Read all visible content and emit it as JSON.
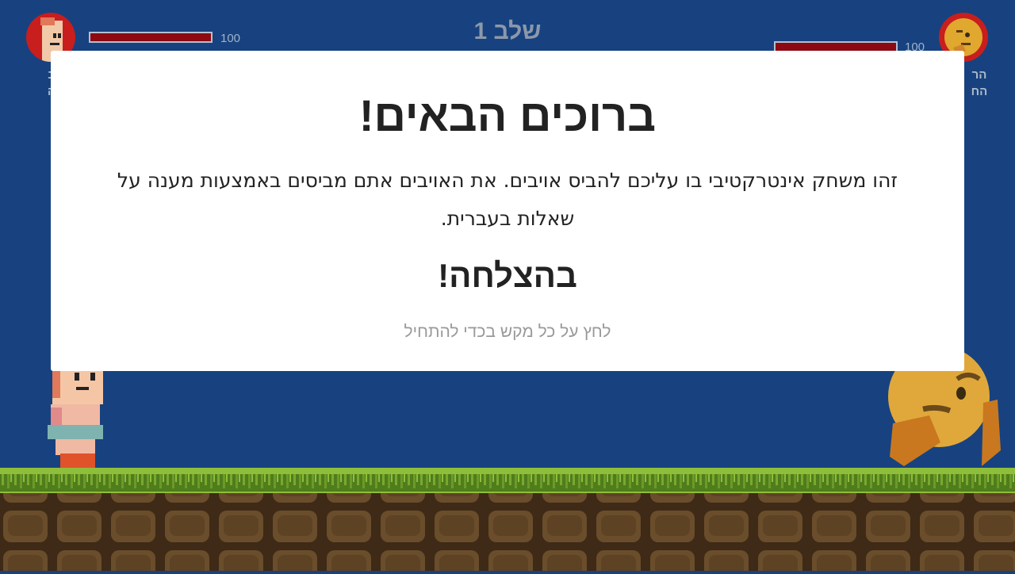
{
  "hud": {
    "level_title": "שלב 1",
    "player": {
      "name": "ב\nה",
      "hp": "100",
      "hp_fraction": 1.0,
      "icon": "player-portrait-icon"
    },
    "enemy": {
      "name": "הר\nהח",
      "hp": "100",
      "hp_fraction": 1.0,
      "icon": "thinking-face-icon"
    }
  },
  "dialog": {
    "title": "ברוכים הבאים!",
    "body": "זהו משחק אינטרקטיבי בו עליכם להביס אויבים. את האויבים אתם מביסים באמצעות מענה על שאלות בעברית.",
    "good_luck": "בהצלחה!",
    "hint": "לחץ על כל מקש בכדי להתחיל"
  },
  "colors": {
    "background": "#17427f",
    "hp_fill": "#8d0a12",
    "grass": "#5b8a1f",
    "dirt": "#5a4124"
  }
}
